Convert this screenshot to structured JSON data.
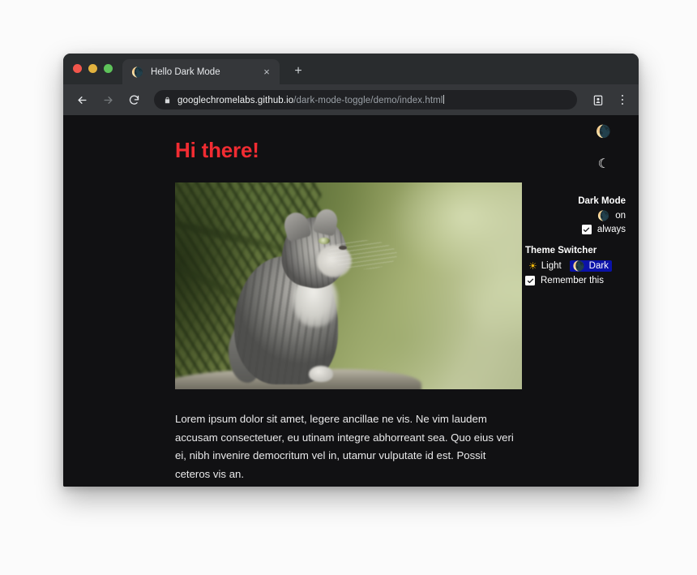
{
  "browser": {
    "tab": {
      "favicon": "moon-emoji",
      "title": "Hello Dark Mode",
      "close_label": "×"
    },
    "new_tab_label": "+",
    "toolbar": {
      "back_icon": "back-arrow-icon",
      "forward_icon": "forward-arrow-icon",
      "reload_icon": "reload-icon",
      "lock_icon": "lock-icon",
      "url_domain": "googlechromelabs.github.io",
      "url_path": "/dark-mode-toggle/demo/index.html",
      "profile_icon": "profile-card-icon",
      "menu_icon": "kebab-menu-icon"
    },
    "traffic_lights": {
      "close_color": "#f2564c",
      "minimize_color": "#e2b23e",
      "maximize_color": "#5ec35a"
    }
  },
  "page": {
    "headline": "Hi there!",
    "headline_color": "#f12c32",
    "background_color": "#111113",
    "floating_moon_filled": "🌘",
    "floating_moon_outline": "☾",
    "photo_alt": "grey tabby kitten sitting on a rock looking up, blurred green conifer background",
    "paragraph": "Lorem ipsum dolor sit amet, legere ancillae ne vis. Ne vim laudem accusam consectetuer, eu utinam integre abhorreant sea. Quo eius veri ei, nibh invenire democritum vel in, utamur vulputate id est. Possit ceteros vis an."
  },
  "panel": {
    "dark_mode": {
      "title": "Dark Mode",
      "toggle_icon": "🌘",
      "toggle_state_label": "on",
      "always_label": "always",
      "always_checked": true
    },
    "theme_switcher": {
      "title": "Theme Switcher",
      "options": [
        {
          "icon": "☀",
          "label": "Light",
          "selected": false
        },
        {
          "icon": "🌘",
          "label": "Dark",
          "selected": true
        }
      ],
      "selected_color": "#0a12a8",
      "remember_label": "Remember this",
      "remember_checked": true
    }
  }
}
